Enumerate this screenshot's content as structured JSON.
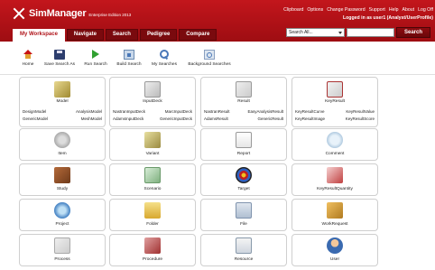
{
  "app": {
    "name": "SimManager",
    "edition": "Enterprise Edition 2013"
  },
  "top_links": [
    "Clipboard",
    "Options",
    "Change Password",
    "Support",
    "Help",
    "About",
    "Log Off"
  ],
  "login_info": "Logged in as user1 (Analyst/UserProfile)",
  "tabs": [
    {
      "label": "My Workspace",
      "active": true
    },
    {
      "label": "Navigate",
      "active": false
    },
    {
      "label": "Search",
      "active": false
    },
    {
      "label": "Pedigree",
      "active": false
    },
    {
      "label": "Compare",
      "active": false
    }
  ],
  "search": {
    "scope": "Search All...",
    "query": "",
    "button_label": "Search"
  },
  "toolbar": [
    {
      "label": "Home",
      "icon": "home-icon"
    },
    {
      "label": "Save Search As",
      "icon": "save-icon"
    },
    {
      "label": "Run Search",
      "icon": "run-icon"
    },
    {
      "label": "Build Search",
      "icon": "build-search-icon"
    },
    {
      "label": "My Searches",
      "icon": "my-searches-icon"
    },
    {
      "label": "Background Searches",
      "icon": "background-searches-icon"
    }
  ],
  "cards": [
    {
      "title": "Model",
      "icon": "model-icon",
      "subs": [
        [
          "DesignModel",
          "AnalysisModel"
        ],
        [
          "GenericModel",
          "MeshModel"
        ]
      ]
    },
    {
      "title": "InputDeck",
      "icon": "inputdeck-icon",
      "subs": [
        [
          "NastranInputDeck",
          "MarcInputDeck"
        ],
        [
          "AdamsInputDeck",
          "GenericInputDeck"
        ]
      ]
    },
    {
      "title": "Result",
      "icon": "result-icon",
      "subs": [
        [
          "NastranResult",
          "EasyAnalysisResult"
        ],
        [
          "AdamsResult",
          "GenericResult"
        ]
      ]
    },
    {
      "title": "KeyResult",
      "icon": "keyresult-icon",
      "subs": [
        [
          "KeyResultCurve",
          "KeyResultValue"
        ],
        [
          "KeyResultImage",
          "KeyResultScore"
        ]
      ]
    },
    {
      "title": "Item",
      "icon": "item-icon",
      "subs": []
    },
    {
      "title": "Variant",
      "icon": "variant-icon",
      "subs": []
    },
    {
      "title": "Report",
      "icon": "report-icon",
      "subs": []
    },
    {
      "title": "Comment",
      "icon": "comment-icon",
      "subs": []
    },
    {
      "title": "Study",
      "icon": "study-icon",
      "subs": []
    },
    {
      "title": "Scenario",
      "icon": "scenario-icon",
      "subs": []
    },
    {
      "title": "Target",
      "icon": "target-icon",
      "subs": []
    },
    {
      "title": "KeyResultQuantity",
      "icon": "keyresultquantity-icon",
      "subs": []
    },
    {
      "title": "Project",
      "icon": "project-icon",
      "subs": []
    },
    {
      "title": "Folder",
      "icon": "folder-icon",
      "subs": []
    },
    {
      "title": "File",
      "icon": "file-icon",
      "subs": []
    },
    {
      "title": "WorkRequest",
      "icon": "workrequest-icon",
      "subs": []
    },
    {
      "title": "Process",
      "icon": "process-icon",
      "subs": []
    },
    {
      "title": "Procedure",
      "icon": "procedure-icon",
      "subs": []
    },
    {
      "title": "Resource",
      "icon": "resource-icon",
      "subs": []
    },
    {
      "title": "User",
      "icon": "user-icon",
      "subs": []
    }
  ],
  "colors": {
    "brand_red": "#b0141a",
    "header_dark": "#7a0a0e",
    "card_border": "#cfcfcf"
  }
}
